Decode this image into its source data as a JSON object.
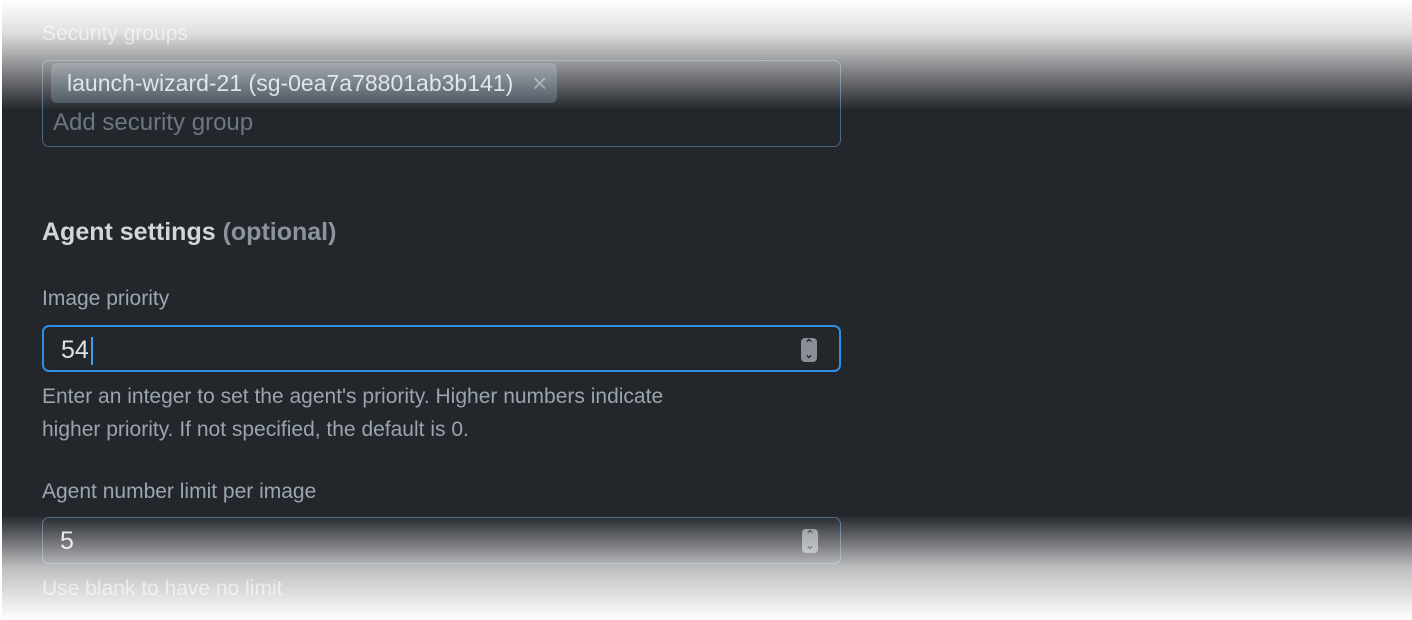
{
  "security_groups": {
    "label": "Security groups",
    "chip": "launch-wizard-21 (sg-0ea7a78801ab3b141)",
    "remove_icon": "×",
    "placeholder": "Add security group"
  },
  "agent_settings": {
    "heading": "Agent settings",
    "optional": "(optional)",
    "image_priority": {
      "label": "Image priority",
      "value": "54",
      "help_line1": "Enter an integer to set the agent's priority. Higher numbers indicate",
      "help_line2": "higher priority. If not specified, the default is 0."
    },
    "agent_limit": {
      "label": "Agent number limit per image",
      "value": "5",
      "help": "Use blank to have no limit"
    }
  },
  "spin_up": "⌃",
  "spin_down": "⌄"
}
